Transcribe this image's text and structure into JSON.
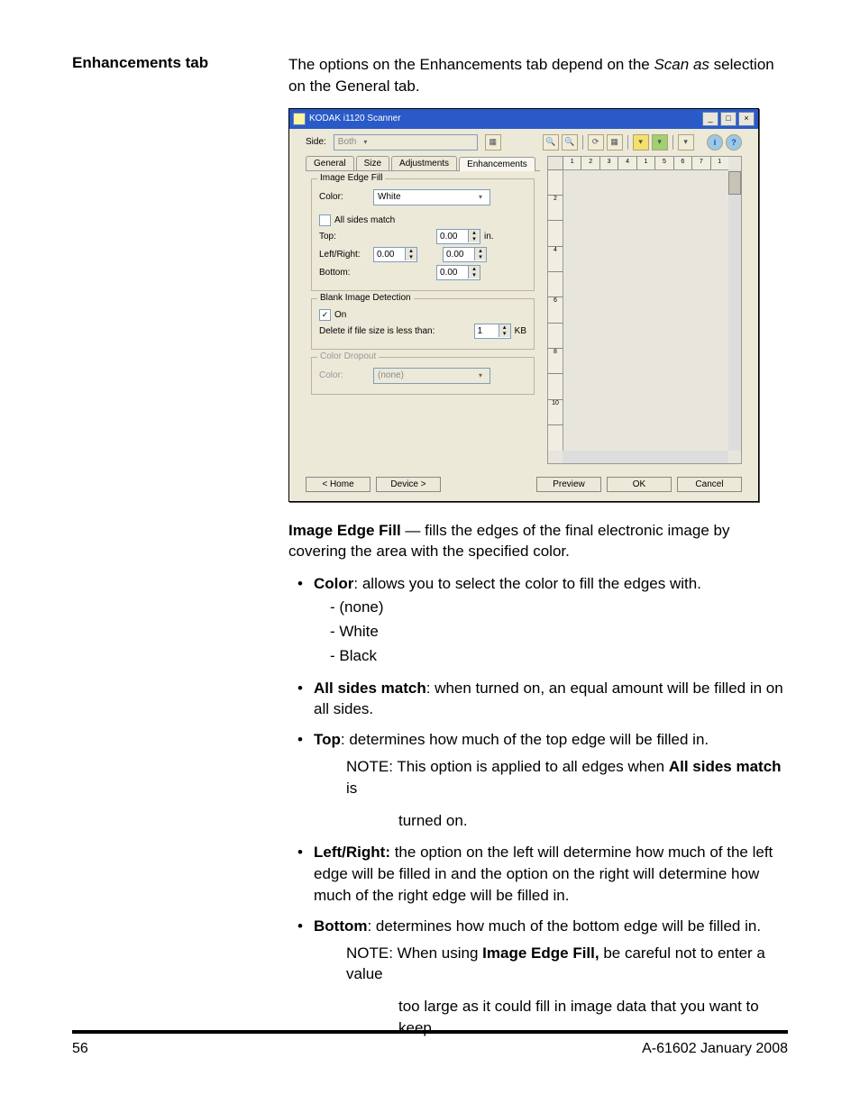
{
  "heading": "Enhancements tab",
  "intro_part1": "The options on the Enhancements tab depend on the ",
  "intro_italic": "Scan as",
  "intro_part2": " selection on the General tab.",
  "screenshot": {
    "title": "KODAK i1120 Scanner",
    "side_label": "Side:",
    "side_value": "Both",
    "ruler_nums": [
      "1",
      "2",
      "3",
      "4",
      "1",
      "5",
      "6",
      "7",
      "1"
    ],
    "tabs": {
      "general": "General",
      "size": "Size",
      "adjustments": "Adjustments",
      "enhancements": "Enhancements"
    },
    "iedge": {
      "group": "Image Edge Fill",
      "color_label": "Color:",
      "color_value": "White",
      "all_sides": "All sides match",
      "top_label": "Top:",
      "top_value": "0.00",
      "top_unit": "in.",
      "lr_label": "Left/Right:",
      "lr_left": "0.00",
      "lr_right": "0.00",
      "bottom_label": "Bottom:",
      "bottom_value": "0.00"
    },
    "blank": {
      "group": "Blank Image Detection",
      "on": "On",
      "delete_label": "Delete if file size is less than:",
      "delete_value": "1",
      "delete_unit": "KB"
    },
    "dropout": {
      "group": "Color Dropout",
      "color_label": "Color:",
      "color_value": "(none)"
    },
    "buttons": {
      "home": "< Home",
      "device": "Device >",
      "preview": "Preview",
      "ok": "OK",
      "cancel": "Cancel"
    },
    "wc_min": "_",
    "wc_max": "□",
    "wc_close": "×"
  },
  "body": {
    "iedge_head": "Image Edge Fill",
    "iedge_text": " — fills the edges of the final electronic image by covering the area with the specified color.",
    "color_head": "Color",
    "color_text": ": allows you to select the color to fill the edges with.",
    "color_opt1": "- (none)",
    "color_opt2": "- White",
    "color_opt3": "- Black",
    "allsides_head": "All sides match",
    "allsides_text": ": when turned on, an equal amount will be filled in on all sides.",
    "top_head": "Top",
    "top_text": ": determines how much of the top edge will be filled in.",
    "top_note_prefix": "NOTE: This option is applied to all edges when ",
    "top_note_bold": "All sides match",
    "top_note_suffix": " is",
    "top_note_line2": "turned on.",
    "lr_head": "Left/Right:",
    "lr_text": " the option on the left will determine how much of the left edge will be filled in and the option on the right will determine how much of the right edge will be filled in.",
    "bottom_head": "Bottom",
    "bottom_text": ": determines how much of the bottom edge will be filled in.",
    "bottom_note_prefix": "NOTE: When using ",
    "bottom_note_bold": "Image Edge Fill,",
    "bottom_note_suffix": " be careful not to enter a value",
    "bottom_note_line2": "too large as it could fill in image data that you want to keep."
  },
  "footer": {
    "page": "56",
    "doc": "A-61602  January 2008"
  }
}
